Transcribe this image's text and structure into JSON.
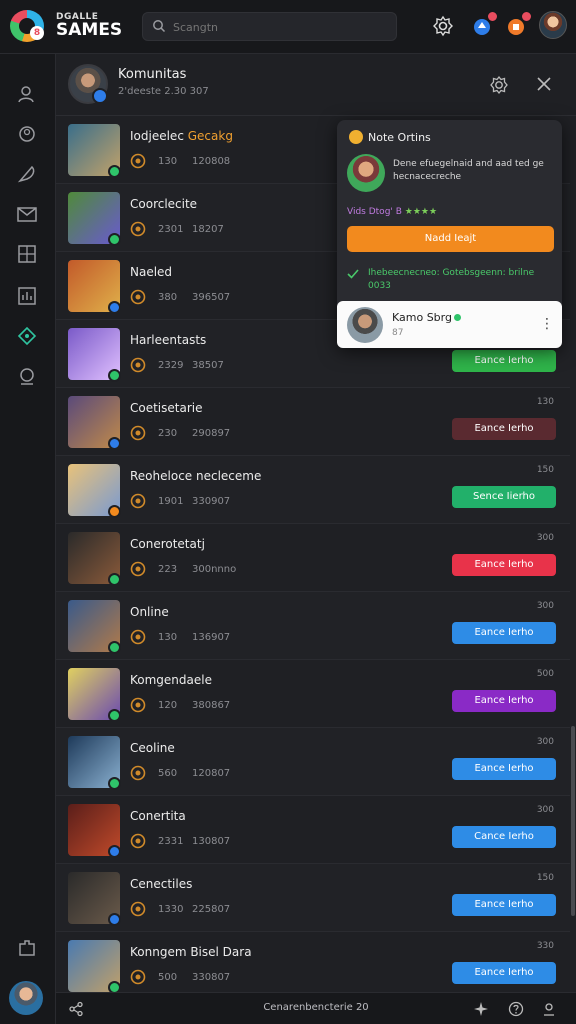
{
  "app": {
    "brand_small": "DGALLE",
    "brand_big": "SAMES",
    "logo_badge": "8",
    "search_placeholder": "Scangtn"
  },
  "topbar_icons": [
    "settings-icon",
    "notification-icon",
    "gift-icon",
    "user-avatar"
  ],
  "header": {
    "title": "Komunitas",
    "subtitle": "2'deeste 2.30 307"
  },
  "popup": {
    "title": "Note Ortins",
    "text": "Dene efuegelnaid and aad ted ge hecnacecreche",
    "tags_purple": "Vids Dtog' B",
    "tags_green": "★★★★",
    "button": "Nadd Ieajt",
    "note": "Ihebeecnecneo: Gotebsgeenn: brilne 0033",
    "card": {
      "name": "Kamo Sbrg",
      "sub": "87"
    }
  },
  "rows": [
    {
      "title": "Iodjeelec",
      "title_accent": "Gecakg",
      "m1": "130",
      "m2": "120808",
      "num": "",
      "button": "",
      "color": "",
      "thumb": [
        "#3a6e8a",
        "#c2a26a"
      ],
      "badge": "#2fc46a"
    },
    {
      "title": "Coorclecite",
      "title_accent": "",
      "m1": "2301",
      "m2": "18207",
      "num": "",
      "button": "",
      "color": "",
      "thumb": [
        "#4f8a3a",
        "#6a5acf"
      ],
      "badge": "#2fc46a"
    },
    {
      "title": "Naeled",
      "title_accent": "",
      "m1": "380",
      "m2": "396507",
      "num": "",
      "button": "",
      "color": "",
      "thumb": [
        "#c25a2a",
        "#e0b04a"
      ],
      "badge": "#2e7de9"
    },
    {
      "title": "Harleentasts",
      "title_accent": "",
      "m1": "2329",
      "m2": "38507",
      "num": "",
      "button": "Eance Ierho",
      "color": "#2fb44a",
      "thumb": [
        "#7a5ac8",
        "#e0c0ff"
      ],
      "badge": "#2fc46a"
    },
    {
      "title": "Coetisetarie",
      "title_accent": "",
      "m1": "230",
      "m2": "290897",
      "num": "130",
      "button": "Eance Ierho",
      "color": "#5a2a30",
      "thumb": [
        "#5a4a7a",
        "#c08a4a"
      ],
      "badge": "#2e7de9"
    },
    {
      "title": "Reoheloce necleceme",
      "title_accent": "",
      "m1": "1901",
      "m2": "330907",
      "num": "150",
      "button": "Sence Iierho",
      "color": "#22b06a",
      "thumb": [
        "#e8c27a",
        "#7a9ad0"
      ],
      "badge": "#f28a1e"
    },
    {
      "title": "Conerotetatj",
      "title_accent": "",
      "m1": "223",
      "m2": "300nnno",
      "num": "300",
      "button": "Eance Ierho",
      "color": "#e8334a",
      "thumb": [
        "#2a2a2a",
        "#8a5a3a"
      ],
      "badge": "#2fc46a"
    },
    {
      "title": "Online",
      "title_accent": "",
      "m1": "130",
      "m2": "136907",
      "num": "300",
      "button": "Eance Ierho",
      "color": "#2e8ce6",
      "thumb": [
        "#3a5a8a",
        "#b07a4a"
      ],
      "badge": "#2fc46a"
    },
    {
      "title": "Komgendaele",
      "title_accent": "",
      "m1": "120",
      "m2": "380867",
      "num": "500",
      "button": "Eance Ierho",
      "color": "#8a2ac6",
      "thumb": [
        "#e0d060",
        "#6a4ab0"
      ],
      "badge": "#2fc46a"
    },
    {
      "title": "Ceoline",
      "title_accent": "",
      "m1": "560",
      "m2": "120807",
      "num": "300",
      "button": "Eance Ierho",
      "color": "#2e8ce6",
      "thumb": [
        "#1e3a5a",
        "#8ab0d0"
      ],
      "badge": "#2fc46a"
    },
    {
      "title": "Conertita",
      "title_accent": "",
      "m1": "2331",
      "m2": "130807",
      "num": "300",
      "button": "Cance Ierho",
      "color": "#2e8ce6",
      "thumb": [
        "#5a1e1a",
        "#c04a2a"
      ],
      "badge": "#2e7de9"
    },
    {
      "title": "Cenectiles",
      "title_accent": "",
      "m1": "1330",
      "m2": "225807",
      "num": "150",
      "button": "Eance Ierho",
      "color": "#2e8ce6",
      "thumb": [
        "#2a2a2a",
        "#6a5a4a"
      ],
      "badge": "#2e7de9"
    },
    {
      "title": "Konngem Bisel Dara",
      "title_accent": "",
      "m1": "500",
      "m2": "330807",
      "num": "330",
      "button": "Eance Ierho",
      "color": "#2e8ce6",
      "thumb": [
        "#4a7ab0",
        "#c0a06a"
      ],
      "badge": "#2fc46a"
    }
  ],
  "footer": {
    "text": "Cenarenbencterie 20"
  }
}
